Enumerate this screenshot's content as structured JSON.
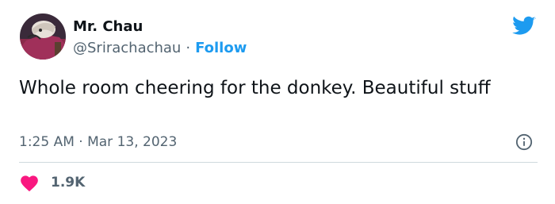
{
  "tweet": {
    "author": {
      "display_name": "Mr. Chau",
      "handle": "@Srirachachau",
      "separator": "·",
      "follow_label": "Follow"
    },
    "text": "Whole room cheering for the donkey. Beautiful stuff",
    "timestamp": "1:25 AM · Mar 13, 2023",
    "likes": {
      "count": "1.9K"
    }
  },
  "icons": {
    "brand": "twitter-bird-icon",
    "info": "info-icon",
    "like": "heart-icon"
  },
  "colors": {
    "accent": "#1d9bf0",
    "heart": "#f91880",
    "text": "#0f1419",
    "secondary": "#536471",
    "divider": "#cfd9de"
  }
}
